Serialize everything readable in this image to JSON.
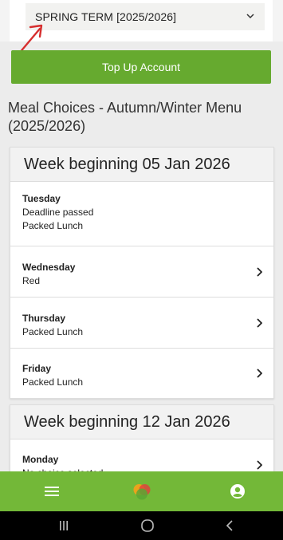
{
  "term": {
    "selected": "SPRING TERM [2025/2026]"
  },
  "topup": {
    "label": "Top Up Account"
  },
  "meals": {
    "title": "Meal Choices - Autumn/Winter Menu (2025/2026)",
    "weeks": [
      {
        "heading": "Week beginning 05 Jan 2026",
        "days": [
          {
            "day": "Tuesday",
            "lines": [
              "Deadline passed",
              "Packed Lunch"
            ]
          },
          {
            "day": "Wednesday",
            "lines": [
              "Red"
            ]
          },
          {
            "day": "Thursday",
            "lines": [
              "Packed Lunch"
            ]
          },
          {
            "day": "Friday",
            "lines": [
              "Packed Lunch"
            ]
          }
        ]
      },
      {
        "heading": "Week beginning 12 Jan 2026",
        "days": [
          {
            "day": "Monday",
            "lines": [
              "No choice selected"
            ]
          }
        ]
      }
    ]
  },
  "colors": {
    "accent": "#66aa2f",
    "nav": "#73b838",
    "annotation_arrow": "#d62e2e"
  },
  "icons": {
    "nav_menu": "hamburger-icon",
    "nav_home": "app-logo-icon",
    "nav_account": "user-circle-icon",
    "sys_recents": "recents-icon",
    "sys_home": "home-circle-icon",
    "sys_back": "back-icon"
  }
}
